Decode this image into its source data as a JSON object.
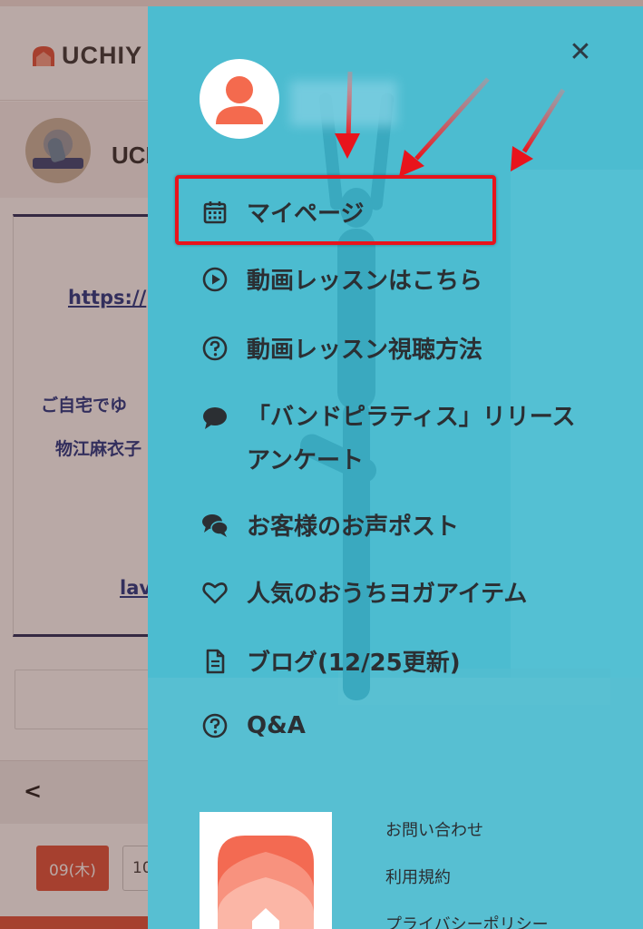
{
  "background_page": {
    "brand": "UCHIY",
    "profile_name": "UCH",
    "link_text": "https://",
    "text_line_1": "ご自宅でゆ",
    "text_line_2": "物江麻衣子",
    "link_text_2": "lav",
    "date_active": "09(木)",
    "date_next": "10",
    "back_icon": "chevron-left-icon"
  },
  "drawer": {
    "close_label": "✕",
    "menu": [
      {
        "label": "マイページ",
        "icon": "calendar-icon"
      },
      {
        "label": "動画レッスンはこちら",
        "icon": "play-circle-icon"
      },
      {
        "label": "動画レッスン視聴方法",
        "icon": "question-circle-icon"
      },
      {
        "label": "「バンドピラティス」リリースアンケート",
        "icon": "comment-icon"
      },
      {
        "label": "お客様のお声ポスト",
        "icon": "comments-icon"
      },
      {
        "label": "人気のおうちヨガアイテム",
        "icon": "heart-icon"
      },
      {
        "label": "ブログ(12/25更新)",
        "icon": "file-icon"
      },
      {
        "label": "Q&A",
        "icon": "question-circle-icon"
      }
    ],
    "footer_links": [
      "お問い合わせ",
      "利用規約",
      "プライバシーポリシー"
    ]
  },
  "colors": {
    "drawer_bg": "#4cbcd0",
    "brand_accent": "#e0563f",
    "highlight": "#e8141c",
    "menu_text": "#2b2f33"
  }
}
